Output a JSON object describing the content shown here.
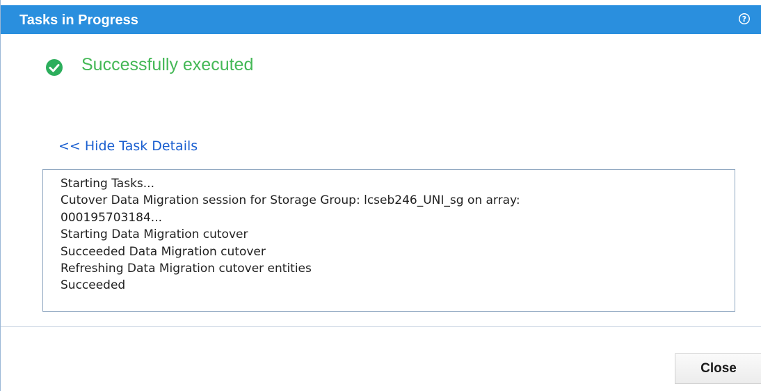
{
  "dialog": {
    "title": "Tasks in Progress",
    "help_icon": "question-icon"
  },
  "status": {
    "icon": "check-circle-icon",
    "text": "Successfully executed",
    "color": "#44b856"
  },
  "details_link": "<< Hide Task Details",
  "log": [
    "Starting Tasks...",
    "Cutover Data Migration session for Storage Group: lcseb246_UNI_sg on array:",
    "000195703184...",
    "Starting Data Migration cutover",
    "Succeeded Data Migration cutover",
    "Refreshing Data Migration cutover entities",
    "Succeeded"
  ],
  "footer": {
    "close_label": "Close"
  },
  "colors": {
    "titlebar": "#2a8fde",
    "link": "#1a5fd0"
  }
}
